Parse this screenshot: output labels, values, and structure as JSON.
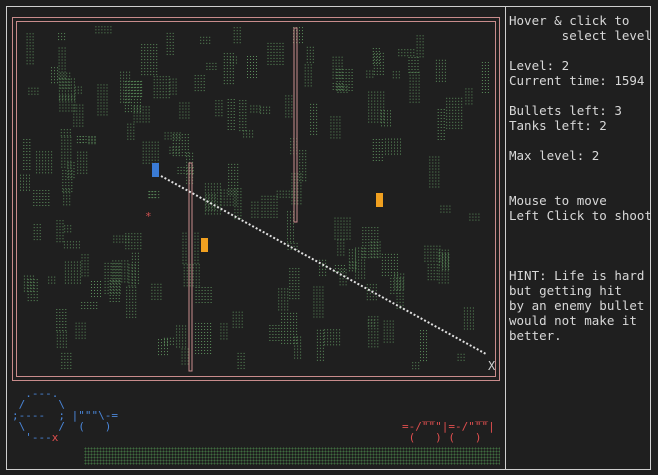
{
  "sidebar": {
    "select_hint": "Hover & click to\n       select level",
    "level": "Level: 2",
    "current_time": "Current time: 1594",
    "bullets_left": "Bullets left: 3",
    "tanks_left": "Tanks left: 2",
    "max_level": "Max level: 2",
    "controls": "Mouse to move\nLeft Click to shoot",
    "hint": "HINT: Life is hard\nbut getting hit\nby an enemy bullet\nwould not make it\nbetter."
  },
  "arena": {
    "target_marker": "X",
    "star_marker": "*",
    "colors": {
      "border": "#c98c8c",
      "vegetation": "#5c8f5c",
      "player": "#3a7bd5",
      "enemy": "#f0a020",
      "trajectory": "#e0e0e0",
      "star": "#d05050"
    }
  },
  "ascii": {
    "player_tank": "  .---.\n /     \\\n;----  ; |\"\"\"\\-=\n \\     /  (   )\n  '---",
    "player_x": "x",
    "enemy_tanks": "   __      __\n=-/\"\"\"|=-/\"\"\"|\n (   ) (   )"
  }
}
